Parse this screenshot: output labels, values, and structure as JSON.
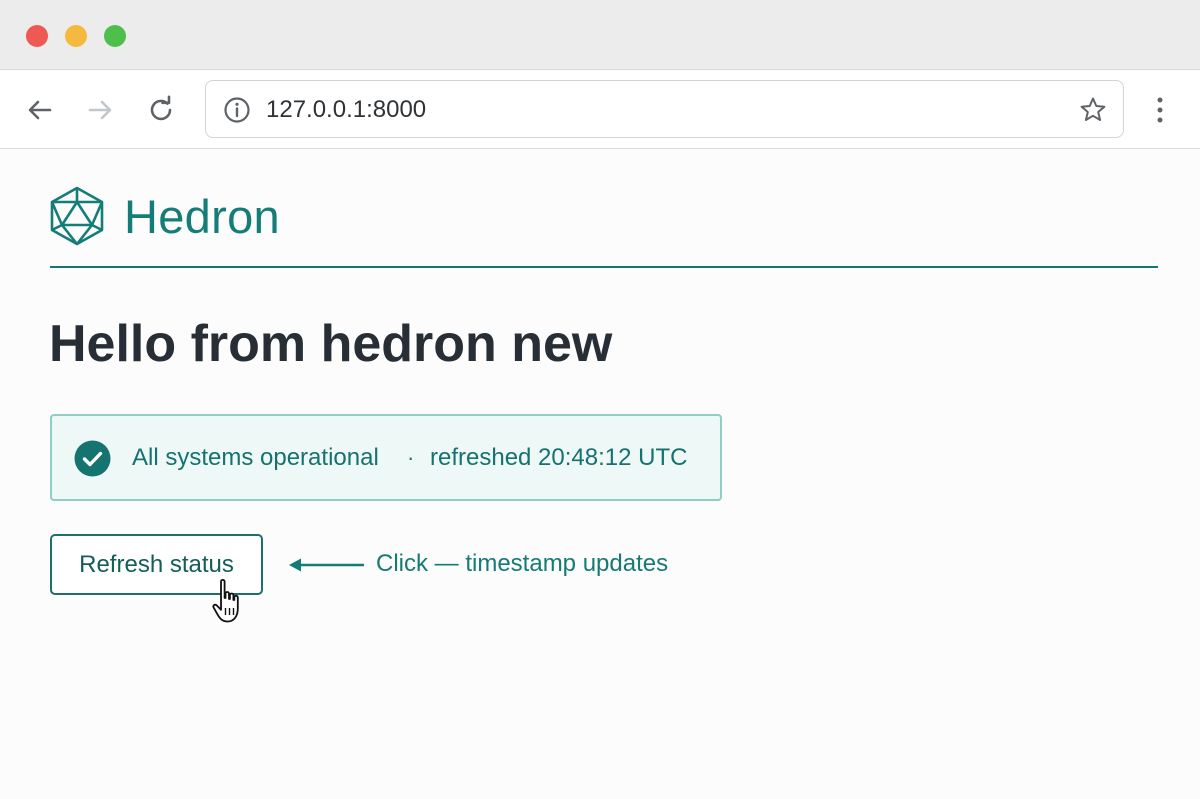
{
  "browser": {
    "url": "127.0.0.1:8000",
    "icons": {
      "back": "arrow-left-icon",
      "forward": "arrow-right-icon",
      "reload": "reload-icon",
      "site_info": "info-icon",
      "bookmark": "star-icon",
      "menu": "kebab-menu-icon"
    }
  },
  "brand": {
    "name": "Hedron",
    "logo": "icosahedron-logo"
  },
  "page": {
    "title": "Hello from hedron new"
  },
  "status": {
    "message": "All systems operational",
    "separator": "·",
    "refreshed": "refreshed 20:48:12 UTC",
    "icon": "check-circle-icon"
  },
  "actions": {
    "refresh_label": "Refresh status",
    "annotation": "Click — timestamp updates"
  },
  "colors": {
    "brand": "#147d78",
    "heading": "#272e36",
    "status_bg": "#eef8f7",
    "status_border": "#8fcdc8",
    "close": "#ee5a52",
    "minimize": "#f4b93e",
    "maximize": "#4fbf4c"
  }
}
